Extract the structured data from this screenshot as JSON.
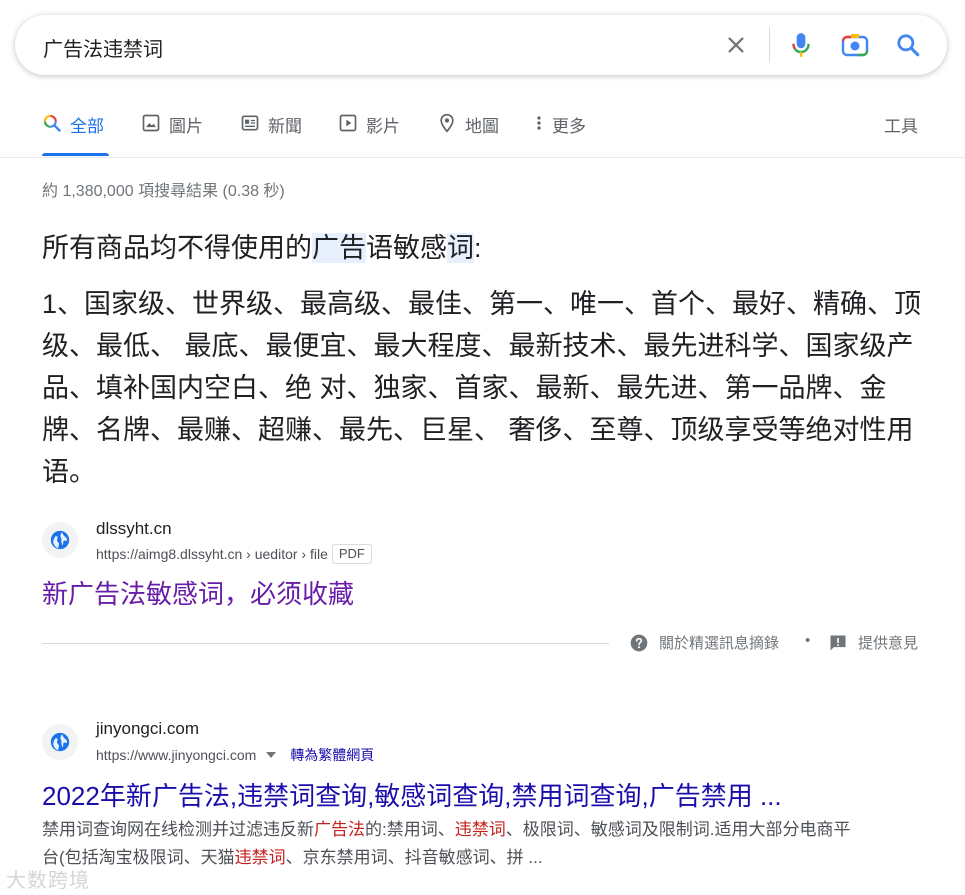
{
  "search": {
    "query": "广告法违禁词",
    "icons": [
      "close-icon",
      "mic-icon",
      "camera-icon",
      "search-icon"
    ]
  },
  "tabs": {
    "all": "全部",
    "images": "圖片",
    "news": "新聞",
    "videos": "影片",
    "maps": "地圖",
    "more": "更多",
    "tools": "工具"
  },
  "stats": "約 1,380,000 項搜尋結果 (0.38 秒)",
  "snippet": {
    "heading_pre": "所有商品均不得使用的",
    "heading_hl1": "广告",
    "heading_mid": "语敏感",
    "heading_hl2": "词",
    "heading_post": ":",
    "body": "1、国家级、世界级、最高级、最佳、第一、唯一、首个、最好、精确、顶级、最低、 最底、最便宜、最大程度、最新技术、最先进科学、国家级产品、填补国内空白、绝 对、独家、首家、最新、最先进、第一品牌、金牌、名牌、最赚、超赚、最先、巨星、 奢侈、至尊、顶级享受等绝对性用语。"
  },
  "result1": {
    "site": "dlssyht.cn",
    "crumb": "https://aimg8.dlssyht.cn › ueditor › file",
    "tag": "PDF",
    "title": "新广告法敏感词，必须收藏"
  },
  "feedback": {
    "about": "關於精選訊息摘錄",
    "dot": "•",
    "give": "提供意見"
  },
  "result2": {
    "site": "jinyongci.com",
    "crumb": "https://www.jinyongci.com",
    "translate": "轉為繁體網頁",
    "title": "2022年新广告法,违禁词查询,敏感词查询,禁用词查询,广告禁用 ...",
    "desc_1": "禁用词查询网在线检测并过滤违反新",
    "desc_em1": "广告法",
    "desc_2": "的:禁用词、",
    "desc_em2": "违禁词",
    "desc_3": "、极限词、敏感词及限制词.适用大部分电商平台(包括淘宝极限词、天猫",
    "desc_em3": "违禁词",
    "desc_4": "、京东禁用词、抖音敏感词、拼 ..."
  },
  "watermark": "大数跨境",
  "colors": {
    "link": "#1a0dab",
    "visited": "#681da8",
    "accent": "#1a73e8",
    "emphasis": "#c5221f"
  }
}
